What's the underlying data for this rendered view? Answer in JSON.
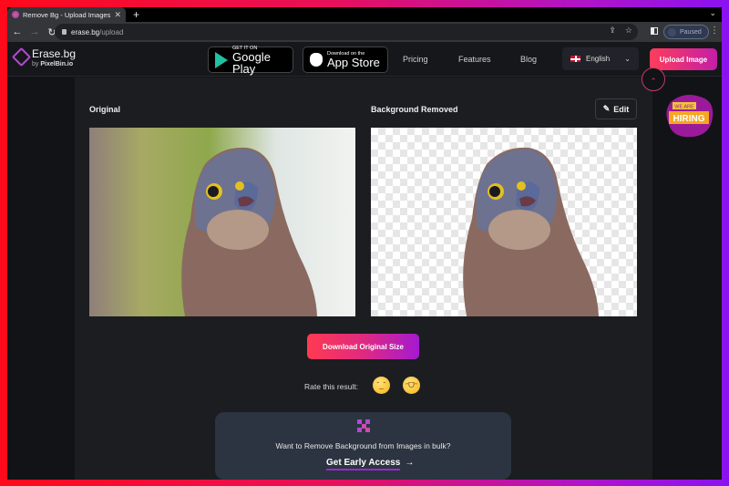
{
  "browser": {
    "tab_title": "Remove Bg - Upload Images to",
    "new_tab_icon": "plus-icon",
    "url_domain": "erase.bg",
    "url_path": "/upload",
    "profile_status": "Paused"
  },
  "header": {
    "logo_name": "Erase.bg",
    "logo_by": "by",
    "logo_brand": "PixelBin.io",
    "google_play_small": "GET IT ON",
    "google_play_big": "Google Play",
    "app_store_small": "Download on the",
    "app_store_big": "App Store",
    "nav": [
      "Pricing",
      "Features",
      "Blog"
    ],
    "language": "English",
    "upload_button": "Upload Image",
    "hiring_badge_top": "WE ARE",
    "hiring_badge_main": "HIRING"
  },
  "main": {
    "original_label": "Original",
    "removed_label": "Background Removed",
    "edit_button": "Edit",
    "download_button": "Download Original Size",
    "rate_label": "Rate this result:",
    "rate_options": [
      "unamused-face",
      "grinning-face"
    ],
    "bulk_question": "Want to Remove Background from Images in bulk?",
    "bulk_cta": "Get Early Access",
    "bulk_cta_arrow": "→"
  },
  "colors": {
    "accent_start": "#ff3d5a",
    "accent_end": "#a41ad0",
    "page_bg": "#121316",
    "panel_bg": "#1c1d21",
    "bulk_bg": "#2b3440"
  }
}
